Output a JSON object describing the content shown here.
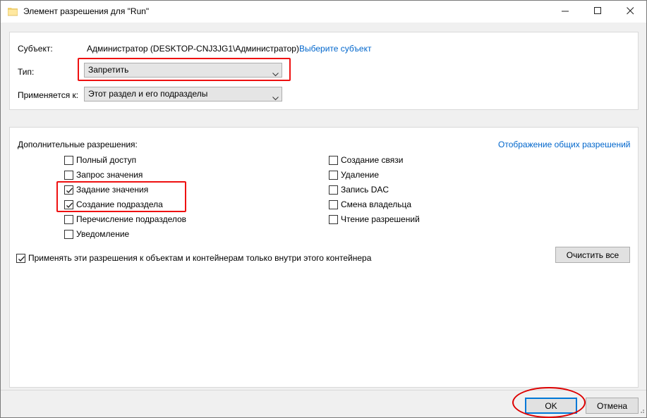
{
  "window": {
    "title": "Элемент разрешения для \"Run\""
  },
  "principal": {
    "label": "Субъект:",
    "value": "Администратор (DESKTOP-CNJ3JG1\\Администратор)",
    "select_link": "Выберите субъект"
  },
  "type": {
    "label": "Тип:",
    "selected": "Запретить"
  },
  "applies_to": {
    "label": "Применяется к:",
    "selected": "Этот раздел и его подразделы"
  },
  "permissions": {
    "heading": "Дополнительные разрешения:",
    "basic_link": "Отображение общих разрешений",
    "left": [
      {
        "label": "Полный доступ",
        "checked": false
      },
      {
        "label": "Запрос значения",
        "checked": false
      },
      {
        "label": "Задание значения",
        "checked": true
      },
      {
        "label": "Создание подраздела",
        "checked": true
      },
      {
        "label": "Перечисление подразделов",
        "checked": false
      },
      {
        "label": "Уведомление",
        "checked": false
      }
    ],
    "right": [
      {
        "label": "Создание связи",
        "checked": false
      },
      {
        "label": "Удаление",
        "checked": false
      },
      {
        "label": "Запись DAC",
        "checked": false
      },
      {
        "label": "Смена владельца",
        "checked": false
      },
      {
        "label": "Чтение разрешений",
        "checked": false
      }
    ]
  },
  "apply_inside": {
    "label": "Применять эти разрешения к объектам и контейнерам только внутри этого контейнера",
    "checked": true
  },
  "buttons": {
    "clear_all": "Очистить все",
    "ok": "OK",
    "cancel": "Отмена"
  },
  "colors": {
    "link": "#0066cc",
    "annotation": "#e11111",
    "accent": "#0078d7"
  }
}
